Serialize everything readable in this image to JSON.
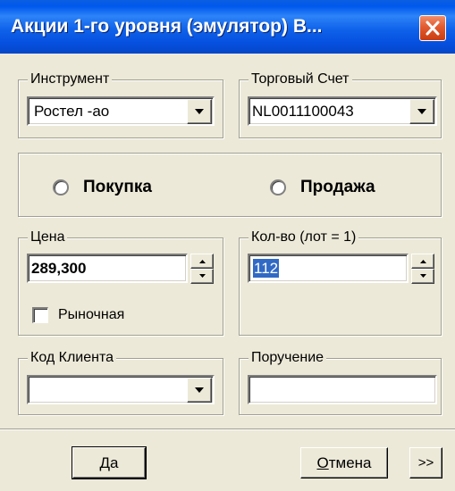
{
  "window": {
    "title": "Акции 1-го уровня (эмулятор) В...",
    "close_icon": "close-icon"
  },
  "instrument": {
    "legend": "Инструмент",
    "value": "Ростел -ао"
  },
  "account": {
    "legend": "Торговый Счет",
    "value": "NL0011100043"
  },
  "side": {
    "buy_label": "Покупка",
    "sell_label": "Продажа",
    "selected": "none"
  },
  "price": {
    "legend": "Цена",
    "value": "289,300",
    "market_label": "Рыночная",
    "market_checked": false
  },
  "quantity": {
    "legend": "Кол-во (лот = 1)",
    "value": "112",
    "selected": true
  },
  "client_code": {
    "legend": "Код Клиента",
    "value": ""
  },
  "order_ref": {
    "legend": "Поручение",
    "value": ""
  },
  "buttons": {
    "ok_label": "Да",
    "ok_mnemonic": "Д",
    "cancel_label": "Отмена",
    "cancel_mnemonic": "О",
    "more_label": ">>"
  },
  "colors": {
    "titlebar": "#0058EE",
    "close": "#E25A30",
    "dialog_bg": "#ECE9D8",
    "selection": "#316AC5"
  }
}
